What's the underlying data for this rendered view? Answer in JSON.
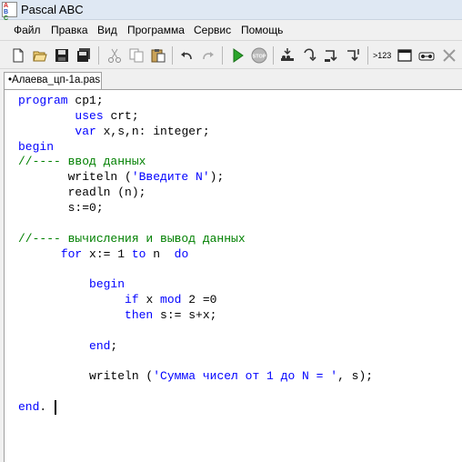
{
  "window": {
    "title": "Pascal ABC"
  },
  "menu": [
    "Файл",
    "Правка",
    "Вид",
    "Программа",
    "Сервис",
    "Помощь"
  ],
  "toolbar": {
    "icons": [
      "new-file-icon",
      "open-file-icon",
      "save-icon",
      "save-all-icon",
      "cut-icon",
      "copy-icon",
      "paste-icon",
      "undo-icon",
      "redo-icon",
      "run-icon",
      "stop-icon",
      "step-into-icon",
      "step-over-icon",
      "step-out-icon",
      "step-to-cursor-icon",
      "watch-icon",
      "output-window-icon",
      "debug-window-icon",
      "close-window-icon"
    ],
    "watch_label": ">123"
  },
  "tab": {
    "label": "•Алаева_цп-1а.pas"
  },
  "code": [
    [
      {
        "t": "program",
        "c": "kw"
      },
      {
        "t": " cp1;",
        "c": "tx"
      }
    ],
    [
      {
        "t": "        ",
        "c": "tx"
      },
      {
        "t": "uses",
        "c": "kw"
      },
      {
        "t": " crt;",
        "c": "tx"
      }
    ],
    [
      {
        "t": "        ",
        "c": "tx"
      },
      {
        "t": "var",
        "c": "kw"
      },
      {
        "t": " x,s,n: integer;",
        "c": "tx"
      }
    ],
    [
      {
        "t": "begin",
        "c": "kw"
      }
    ],
    [
      {
        "t": "//---- ввод данных",
        "c": "cm"
      }
    ],
    [
      {
        "t": "       writeln (",
        "c": "tx"
      },
      {
        "t": "'Введите N'",
        "c": "st"
      },
      {
        "t": ");",
        "c": "tx"
      }
    ],
    [
      {
        "t": "       readln (n);",
        "c": "tx"
      }
    ],
    [
      {
        "t": "       s:=0;",
        "c": "tx"
      }
    ],
    [],
    [
      {
        "t": "//---- вычисления и вывод данных",
        "c": "cm"
      }
    ],
    [
      {
        "t": "      ",
        "c": "tx"
      },
      {
        "t": "for",
        "c": "kw"
      },
      {
        "t": " x:= 1 ",
        "c": "tx"
      },
      {
        "t": "to",
        "c": "kw"
      },
      {
        "t": " n  ",
        "c": "tx"
      },
      {
        "t": "do",
        "c": "kw"
      }
    ],
    [],
    [
      {
        "t": "          ",
        "c": "tx"
      },
      {
        "t": "begin",
        "c": "kw"
      }
    ],
    [
      {
        "t": "               ",
        "c": "tx"
      },
      {
        "t": "if",
        "c": "kw"
      },
      {
        "t": " x ",
        "c": "tx"
      },
      {
        "t": "mod",
        "c": "kw"
      },
      {
        "t": " 2 =0",
        "c": "tx"
      }
    ],
    [
      {
        "t": "               ",
        "c": "tx"
      },
      {
        "t": "then",
        "c": "kw"
      },
      {
        "t": " s:= s+x;",
        "c": "tx"
      }
    ],
    [],
    [
      {
        "t": "          ",
        "c": "tx"
      },
      {
        "t": "end",
        "c": "kw"
      },
      {
        "t": ";",
        "c": "tx"
      }
    ],
    [],
    [
      {
        "t": "          writeln (",
        "c": "tx"
      },
      {
        "t": "'Сумма чисел от 1 до N = '",
        "c": "st"
      },
      {
        "t": ", s);",
        "c": "tx"
      }
    ],
    [],
    [
      {
        "t": "end",
        "c": "kw"
      },
      {
        "t": ".",
        "c": "tx"
      }
    ]
  ]
}
